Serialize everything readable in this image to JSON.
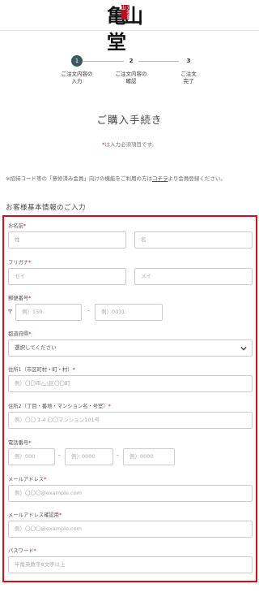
{
  "header": {
    "logo_text": "亀山堂",
    "seal_text": "元祖亀山"
  },
  "steps": [
    {
      "number": "1",
      "label_line1": "ご注文内容の",
      "label_line2": "入力"
    },
    {
      "number": "2",
      "label_line1": "ご注文内容の",
      "label_line2": "確認"
    },
    {
      "number": "3",
      "label_line1": "ご注文",
      "label_line2": "完了"
    }
  ],
  "page_title": "ご購入手続き",
  "required_note": {
    "star": "*",
    "text": "は入力必須項目です。"
  },
  "invite_note": {
    "before": "※招待コード等の「意修済み会員」向けの機能をご利用の方は",
    "link": "コチラ",
    "after": "より会員登録ください。"
  },
  "section_title": "お客様基本情報のご入力",
  "form": {
    "name": {
      "label": "お名前",
      "star": "*",
      "last_placeholder": "姓",
      "first_placeholder": "名"
    },
    "kana": {
      "label": "フリガナ",
      "star": "*",
      "last_placeholder": "セイ",
      "first_placeholder": "メイ"
    },
    "postal": {
      "label": "郵便番号",
      "star": "*",
      "prefix": "〒",
      "first_placeholder": "例）150",
      "dash": "-",
      "second_placeholder": "例）0031"
    },
    "prefecture": {
      "label": "都道府県",
      "star": "*",
      "selected": "選択してください"
    },
    "address1": {
      "label": "住所1（市区町村・町・村）",
      "star": "*",
      "placeholder": "例）〇〇市△△区〇〇町"
    },
    "address2": {
      "label": "住所2（丁目・番地・マンション名・号室）",
      "star": "*",
      "placeholder": "例）〇〇 1-4 〇〇マンション101号"
    },
    "phone": {
      "label": "電話番号",
      "star": "*",
      "p1": "例）000",
      "p2": "例）0000",
      "p3": "例）0000",
      "dash": "-"
    },
    "email": {
      "label": "メールアドレス",
      "star": "*",
      "placeholder": "例）〇〇〇@example.com"
    },
    "email_confirm": {
      "label": "メールアドレス確認用",
      "star": "*",
      "placeholder": "例）〇〇〇@example.com"
    },
    "password": {
      "label": "パスワード",
      "star": "*",
      "placeholder": "半角英数字8文字以上"
    }
  },
  "colors": {
    "accent": "#3a5963",
    "required": "#c8102e",
    "highlight_border": "#d2101e",
    "link": "#1d5c93"
  }
}
